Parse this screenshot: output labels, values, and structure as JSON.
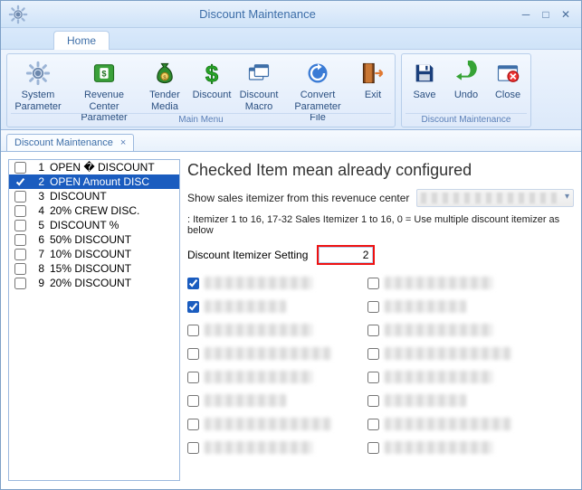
{
  "titlebar": {
    "title": "Discount Maintenance"
  },
  "ribbon": {
    "tab_home": "Home",
    "groups": {
      "main_menu": {
        "caption": "Main Menu",
        "buttons": {
          "system_parameter": "System Parameter",
          "revenue_center_parameter": "Revenue Center Parameter",
          "tender_media": "Tender Media",
          "discount": "Discount",
          "discount_macro": "Discount Macro",
          "convert_parameter_file": "Convert Parameter File",
          "exit": "Exit"
        }
      },
      "discount_maintenance": {
        "caption": "Discount Maintenance",
        "buttons": {
          "save": "Save",
          "undo": "Undo",
          "close": "Close"
        }
      }
    }
  },
  "doc_tab": {
    "label": "Discount Maintenance"
  },
  "list": {
    "items": [
      {
        "num": "1",
        "label": "OPEN � DISCOUNT",
        "checked": false,
        "selected": false
      },
      {
        "num": "2",
        "label": "OPEN Amount DISC",
        "checked": true,
        "selected": true
      },
      {
        "num": "3",
        "label": "DISCOUNT",
        "checked": false,
        "selected": false
      },
      {
        "num": "4",
        "label": "20% CREW DISC.",
        "checked": false,
        "selected": false
      },
      {
        "num": "5",
        "label": "DISCOUNT %",
        "checked": false,
        "selected": false
      },
      {
        "num": "6",
        "label": "50% DISCOUNT",
        "checked": false,
        "selected": false
      },
      {
        "num": "7",
        "label": "10% DISCOUNT",
        "checked": false,
        "selected": false
      },
      {
        "num": "8",
        "label": "15% DISCOUNT",
        "checked": false,
        "selected": false
      },
      {
        "num": "9",
        "label": "20% DISCOUNT",
        "checked": false,
        "selected": false
      }
    ]
  },
  "panel": {
    "heading": "Checked Item mean already configured",
    "rc_label": "Show sales itemizer from this revenuce center",
    "note": ": Itemizer 1 to 16, 17-32 Sales Itemizer 1 to 16, 0 = Use multiple discount itemizer as below",
    "setting_label": "Discount Itemizer Setting",
    "setting_value": "2",
    "itemizers_left": [
      {
        "checked": true
      },
      {
        "checked": true
      },
      {
        "checked": false
      },
      {
        "checked": false
      },
      {
        "checked": false
      },
      {
        "checked": false
      },
      {
        "checked": false
      },
      {
        "checked": false
      }
    ],
    "itemizers_right": [
      {
        "checked": false
      },
      {
        "checked": false
      },
      {
        "checked": false
      },
      {
        "checked": false
      },
      {
        "checked": false
      },
      {
        "checked": false
      },
      {
        "checked": false
      },
      {
        "checked": false
      }
    ]
  }
}
